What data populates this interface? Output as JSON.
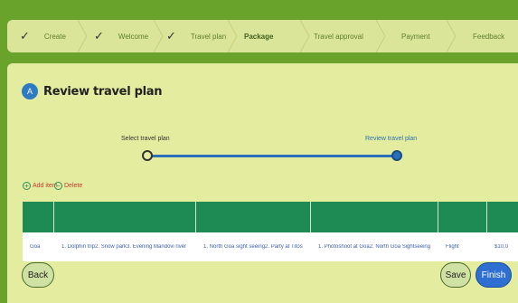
{
  "wizard": {
    "steps": [
      {
        "label": "Create",
        "done": true
      },
      {
        "label": "Welcome",
        "done": true
      },
      {
        "label": "Travel plan",
        "done": true
      },
      {
        "label": "Package",
        "active": true
      },
      {
        "label": "Travel approval"
      },
      {
        "label": "Payment"
      },
      {
        "label": "Feedback"
      }
    ],
    "check_glyph": "✓"
  },
  "section": {
    "badge": "A",
    "title": "Review travel plan"
  },
  "progress": {
    "left_label": "Select travel plan",
    "right_label": "Review travel plan"
  },
  "actions": {
    "add_label": "Add item",
    "delete_label": "Delete"
  },
  "table": {
    "row": [
      "Goa",
      "1. Dolphin trip2. Snow park3. Evening Mandovi river",
      "1. North Goa sight seeing2. Party at Titos",
      "1. Photoshoot at Goa2. North Goa Sightseeing",
      "Flight",
      "$10,0"
    ]
  },
  "buttons": {
    "back": "Back",
    "save": "Save",
    "finish": "Finish"
  },
  "colors": {
    "background": "#6aa32c",
    "panel": "#e4ed9f",
    "table_header": "#1f8b54",
    "accent_blue": "#2e6fd1"
  }
}
